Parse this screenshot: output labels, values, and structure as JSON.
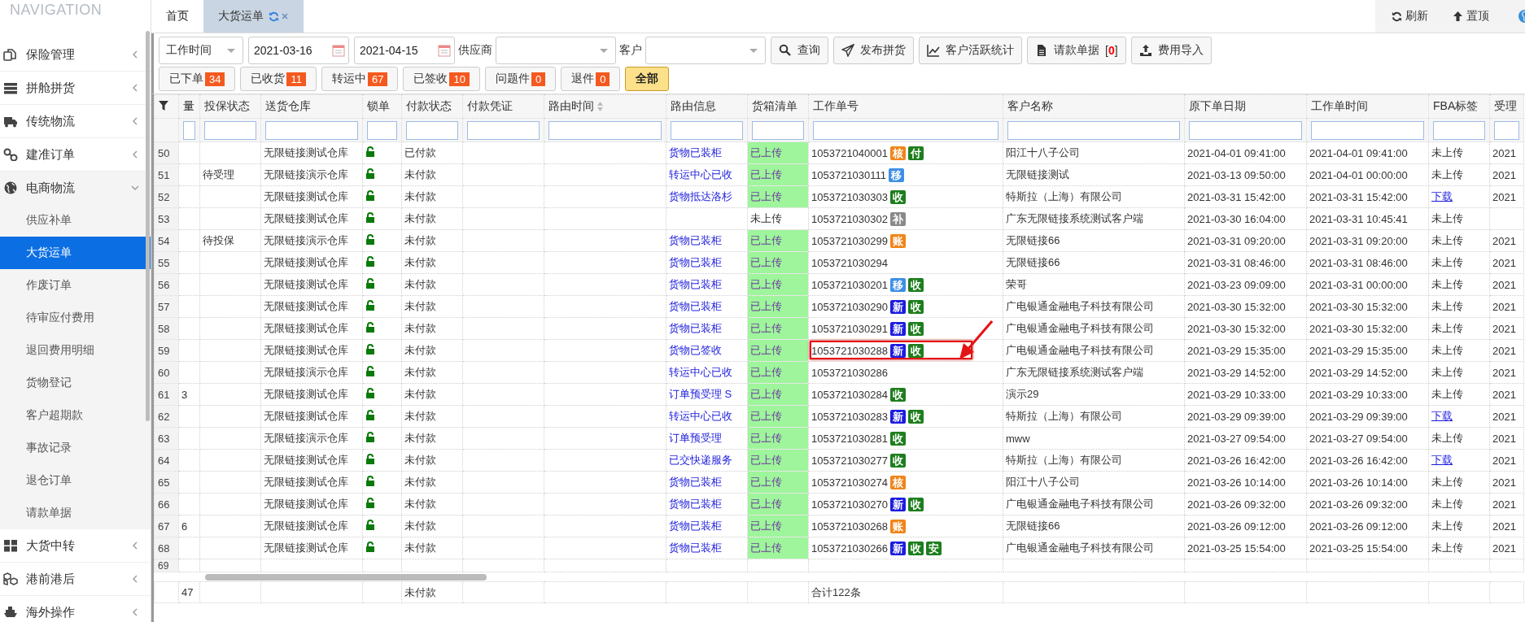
{
  "navigation": {
    "title": "NAVIGATION",
    "items": [
      {
        "label": "保险管理",
        "expanded": false
      },
      {
        "label": "拼舱拼货",
        "expanded": false
      },
      {
        "label": "传统物流",
        "expanded": false
      },
      {
        "label": "建准订单",
        "expanded": false
      },
      {
        "label": "电商物流",
        "expanded": true,
        "children": [
          {
            "label": "供应补单",
            "selected": false
          },
          {
            "label": "大货运单",
            "selected": true
          },
          {
            "label": "作废订单",
            "selected": false
          },
          {
            "label": "待审应付费用",
            "selected": false
          },
          {
            "label": "退回费用明细",
            "selected": false
          },
          {
            "label": "货物登记",
            "selected": false
          },
          {
            "label": "客户超期款",
            "selected": false
          },
          {
            "label": "事故记录",
            "selected": false
          },
          {
            "label": "退仓订单",
            "selected": false
          },
          {
            "label": "请款单据",
            "selected": false
          }
        ]
      },
      {
        "label": "大货中转",
        "expanded": false
      },
      {
        "label": "港前港后",
        "expanded": false
      },
      {
        "label": "海外操作",
        "expanded": false
      }
    ]
  },
  "tabs": [
    {
      "label": "首页",
      "selected": false,
      "closable": false
    },
    {
      "label": "大货运单",
      "selected": true,
      "closable": true
    }
  ],
  "top_actions": [
    {
      "label": "刷新"
    },
    {
      "label": "置顶"
    }
  ],
  "filters": {
    "time_field": {
      "value": "工作时间"
    },
    "date_from": {
      "value": "2021-03-16"
    },
    "date_to": {
      "value": "2021-04-15"
    },
    "supplier": {
      "label": "供应商"
    },
    "customer": {
      "label": "客户"
    }
  },
  "toolbar_buttons": [
    {
      "label": "查询"
    },
    {
      "label": "发布拼货"
    },
    {
      "label": "客户活跃统计"
    },
    {
      "label": "请款单据",
      "count": "[**0**]"
    },
    {
      "label": "费用导入"
    }
  ],
  "status_buttons": [
    {
      "label": "已下单",
      "count": "34",
      "selected": false
    },
    {
      "label": "已收货",
      "count": "11",
      "selected": false
    },
    {
      "label": "转运中",
      "count": "67",
      "selected": false
    },
    {
      "label": "已签收",
      "count": "10",
      "selected": false
    },
    {
      "label": "问题件",
      "count": "0",
      "selected": false
    },
    {
      "label": "退件",
      "count": "0",
      "selected": false
    },
    {
      "label": "全部",
      "selected": true
    }
  ],
  "table": {
    "columns": [
      {
        "label": "量",
        "sortable": false
      },
      {
        "label": "投保状态",
        "sortable": false
      },
      {
        "label": "送货仓库",
        "sortable": false
      },
      {
        "label": "锁单",
        "sortable": false
      },
      {
        "label": "付款状态",
        "sortable": false
      },
      {
        "label": "付款凭证",
        "sortable": false
      },
      {
        "label": "路由时间",
        "sortable": true
      },
      {
        "label": "路由信息",
        "sortable": false
      },
      {
        "label": "货箱清单",
        "sortable": false
      },
      {
        "label": "工作单号",
        "sortable": false
      },
      {
        "label": "客户名称",
        "sortable": false
      },
      {
        "label": "原下单日期",
        "sortable": false
      },
      {
        "label": "工作单时间",
        "sortable": false
      },
      {
        "label": "FBA标签",
        "sortable": false
      },
      {
        "label": "受理",
        "sortable": false
      }
    ],
    "rows": [
      {
        "number": "50",
        "warehouse": "无限链接测试仓库",
        "locked": false,
        "payment_status": "已付款",
        "route_info": "货物已装柜",
        "packing_list": {
          "text": "已上传",
          "uploaded": true
        },
        "work_order": {
          "number": "1053721040001",
          "tags": [
            {
              "text": "核",
              "color": "#f08519"
            },
            {
              "text": "付",
              "color": "#1e7e1e"
            }
          ],
          "highlighted": false
        },
        "customer": "阳江十八子公司",
        "order_date": "2021-04-01 09:41:00",
        "work_order_time": "2021-04-01 09:41:00",
        "fba_label": {
          "text": "未上传",
          "link": false
        },
        "acceptance": "2021"
      },
      {
        "number": "51",
        "insurance_status": "待受理",
        "warehouse": "无限链接演示仓库",
        "locked": false,
        "payment_status": "未付款",
        "route_info": "转运中心已收",
        "packing_list": {
          "text": "已上传",
          "uploaded": true
        },
        "work_order": {
          "number": "1053721030111",
          "tags": [
            {
              "text": "移",
              "color": "#3d8fe6"
            }
          ],
          "highlighted": false
        },
        "customer": "无限链接测试",
        "order_date": "2021-03-13 09:50:00",
        "work_order_time": "2021-04-01 00:00:00",
        "fba_label": {
          "text": "未上传",
          "link": false
        },
        "acceptance": "2021"
      },
      {
        "number": "52",
        "warehouse": "无限链接测试仓库",
        "locked": false,
        "payment_status": "未付款",
        "route_info": "货物抵达洛杉",
        "packing_list": {
          "text": "已上传",
          "uploaded": true
        },
        "work_order": {
          "number": "1053721030303",
          "tags": [
            {
              "text": "收",
              "color": "#1e7e1e"
            }
          ],
          "highlighted": false
        },
        "customer": "特斯拉（上海）有限公司",
        "order_date": "2021-03-31 15:42:00",
        "work_order_time": "2021-03-31 15:42:00",
        "fba_label": {
          "text": "下载",
          "link": true
        },
        "acceptance": "2021"
      },
      {
        "number": "53",
        "warehouse": "无限链接测试仓库",
        "locked": false,
        "payment_status": "未付款",
        "packing_list": {
          "text": "未上传",
          "uploaded": false
        },
        "work_order": {
          "number": "1053721030302",
          "tags": [
            {
              "text": "补",
              "color": "#8a8a8a"
            }
          ],
          "highlighted": false
        },
        "customer": "广东无限链接系统测试客户端",
        "order_date": "2021-03-30 16:04:00",
        "work_order_time": "2021-03-31 10:45:41",
        "fba_label": {
          "text": "未上传",
          "link": false
        }
      },
      {
        "number": "54",
        "insurance_status": "待投保",
        "warehouse": "无限链接演示仓库",
        "locked": false,
        "payment_status": "未付款",
        "route_info": "货物已装柜",
        "packing_list": {
          "text": "已上传",
          "uploaded": true
        },
        "work_order": {
          "number": "1053721030299",
          "tags": [
            {
              "text": "账",
              "color": "#f08519"
            }
          ],
          "highlighted": false
        },
        "customer": "无限链接66",
        "order_date": "2021-03-31 09:20:00",
        "work_order_time": "2021-03-31 09:20:00",
        "fba_label": {
          "text": "未上传",
          "link": false
        },
        "acceptance": "2021"
      },
      {
        "number": "55",
        "warehouse": "无限链接测试仓库",
        "locked": false,
        "payment_status": "未付款",
        "route_info": "货物已装柜",
        "packing_list": {
          "text": "已上传",
          "uploaded": true
        },
        "work_order": {
          "number": "1053721030294",
          "highlighted": false
        },
        "customer": "无限链接66",
        "order_date": "2021-03-31 08:46:00",
        "work_order_time": "2021-03-31 08:46:00",
        "fba_label": {
          "text": "未上传",
          "link": false
        },
        "acceptance": "2021"
      },
      {
        "number": "56",
        "warehouse": "无限链接测试仓库",
        "locked": false,
        "payment_status": "未付款",
        "route_info": "货物已装柜",
        "packing_list": {
          "text": "已上传",
          "uploaded": true
        },
        "work_order": {
          "number": "1053721030201",
          "tags": [
            {
              "text": "移",
              "color": "#3d8fe6"
            },
            {
              "text": "收",
              "color": "#1e7e1e"
            }
          ],
          "highlighted": false
        },
        "customer": "荣哥",
        "order_date": "2021-03-23 09:09:00",
        "work_order_time": "2021-03-31 00:00:00",
        "fba_label": {
          "text": "未上传",
          "link": false
        },
        "acceptance": "2021"
      },
      {
        "number": "57",
        "warehouse": "无限链接测试仓库",
        "locked": false,
        "payment_status": "未付款",
        "route_info": "货物已装柜",
        "packing_list": {
          "text": "已上传",
          "uploaded": true
        },
        "work_order": {
          "number": "1053721030290",
          "tags": [
            {
              "text": "新",
              "color": "#1c1ce0"
            },
            {
              "text": "收",
              "color": "#1e7e1e"
            }
          ],
          "highlighted": false
        },
        "customer": "广电银通金融电子科技有限公司",
        "order_date": "2021-03-30 15:32:00",
        "work_order_time": "2021-03-30 15:32:00",
        "fba_label": {
          "text": "未上传",
          "link": false
        },
        "acceptance": "2021"
      },
      {
        "number": "58",
        "warehouse": "无限链接测试仓库",
        "locked": false,
        "payment_status": "未付款",
        "route_info": "货物已装柜",
        "packing_list": {
          "text": "已上传",
          "uploaded": true
        },
        "work_order": {
          "number": "1053721030291",
          "tags": [
            {
              "text": "新",
              "color": "#1c1ce0"
            },
            {
              "text": "收",
              "color": "#1e7e1e"
            }
          ],
          "highlighted": false
        },
        "customer": "广电银通金融电子科技有限公司",
        "order_date": "2021-03-30 15:32:00",
        "work_order_time": "2021-03-30 15:32:00",
        "fba_label": {
          "text": "未上传",
          "link": false
        },
        "acceptance": "2021"
      },
      {
        "number": "59",
        "warehouse": "无限链接测试仓库",
        "locked": false,
        "payment_status": "未付款",
        "route_info": "货物已签收",
        "packing_list": {
          "text": "已上传",
          "uploaded": true
        },
        "work_order": {
          "number": "1053721030288",
          "tags": [
            {
              "text": "新",
              "color": "#1c1ce0"
            },
            {
              "text": "收",
              "color": "#1e7e1e"
            }
          ],
          "highlighted": true
        },
        "customer": "广电银通金融电子科技有限公司",
        "order_date": "2021-03-29 15:35:00",
        "work_order_time": "2021-03-29 15:35:00",
        "fba_label": {
          "text": "未上传",
          "link": false
        },
        "acceptance": "2021"
      },
      {
        "number": "60",
        "warehouse": "无限链接演示仓库",
        "locked": false,
        "payment_status": "未付款",
        "route_info": "转运中心已收",
        "packing_list": {
          "text": "已上传",
          "uploaded": true
        },
        "work_order": {
          "number": "1053721030286",
          "highlighted": false
        },
        "customer": "广东无限链接系统测试客户端",
        "order_date": "2021-03-29 14:52:00",
        "work_order_time": "2021-03-29 14:52:00",
        "fba_label": {
          "text": "未上传",
          "link": false
        },
        "acceptance": "2021"
      },
      {
        "number": "61",
        "quantity": "3",
        "warehouse": "无限链接测试仓库",
        "locked": false,
        "payment_status": "未付款",
        "route_info": "订单预受理 S",
        "packing_list": {
          "text": "已上传",
          "uploaded": true
        },
        "work_order": {
          "number": "1053721030284",
          "tags": [
            {
              "text": "收",
              "color": "#1e7e1e"
            }
          ],
          "highlighted": false
        },
        "customer": "演示29",
        "order_date": "2021-03-29 10:33:00",
        "work_order_time": "2021-03-29 10:33:00",
        "fba_label": {
          "text": "未上传",
          "link": false
        },
        "acceptance": "2021"
      },
      {
        "number": "62",
        "warehouse": "无限链接测试仓库",
        "locked": false,
        "payment_status": "未付款",
        "route_info": "转运中心已收",
        "packing_list": {
          "text": "已上传",
          "uploaded": true
        },
        "work_order": {
          "number": "1053721030283",
          "tags": [
            {
              "text": "新",
              "color": "#1c1ce0"
            },
            {
              "text": "收",
              "color": "#1e7e1e"
            }
          ],
          "highlighted": false
        },
        "customer": "特斯拉（上海）有限公司",
        "order_date": "2021-03-29 09:39:00",
        "work_order_time": "2021-03-29 09:39:00",
        "fba_label": {
          "text": "下载",
          "link": true
        },
        "acceptance": "2021"
      },
      {
        "number": "63",
        "warehouse": "无限链接演示仓库",
        "locked": false,
        "payment_status": "未付款",
        "route_info": "订单预受理",
        "packing_list": {
          "text": "已上传",
          "uploaded": true
        },
        "work_order": {
          "number": "1053721030281",
          "tags": [
            {
              "text": "收",
              "color": "#1e7e1e"
            }
          ],
          "highlighted": false
        },
        "customer": "mww",
        "order_date": "2021-03-27 09:54:00",
        "work_order_time": "2021-03-27 09:54:00",
        "fba_label": {
          "text": "未上传",
          "link": false
        },
        "acceptance": "2021"
      },
      {
        "number": "64",
        "warehouse": "无限链接测试仓库",
        "locked": false,
        "payment_status": "未付款",
        "route_info": "已交快递服务",
        "packing_list": {
          "text": "已上传",
          "uploaded": true
        },
        "work_order": {
          "number": "1053721030277",
          "tags": [
            {
              "text": "收",
              "color": "#1e7e1e"
            }
          ],
          "highlighted": false
        },
        "customer": "特斯拉（上海）有限公司",
        "order_date": "2021-03-26 16:42:00",
        "work_order_time": "2021-03-26 16:42:00",
        "fba_label": {
          "text": "下载",
          "link": true
        },
        "acceptance": "2021"
      },
      {
        "number": "65",
        "warehouse": "无限链接测试仓库",
        "locked": false,
        "payment_status": "未付款",
        "route_info": "货物已装柜",
        "packing_list": {
          "text": "已上传",
          "uploaded": true
        },
        "work_order": {
          "number": "1053721030274",
          "tags": [
            {
              "text": "核",
              "color": "#f08519"
            }
          ],
          "highlighted": false
        },
        "customer": "阳江十八子公司",
        "order_date": "2021-03-26 10:14:00",
        "work_order_time": "2021-03-26 10:14:00",
        "fba_label": {
          "text": "未上传",
          "link": false
        },
        "acceptance": "2021"
      },
      {
        "number": "66",
        "warehouse": "无限链接测试仓库",
        "locked": false,
        "payment_status": "未付款",
        "route_info": "货物已装柜",
        "packing_list": {
          "text": "已上传",
          "uploaded": true
        },
        "work_order": {
          "number": "1053721030270",
          "tags": [
            {
              "text": "新",
              "color": "#1c1ce0"
            },
            {
              "text": "收",
              "color": "#1e7e1e"
            }
          ],
          "highlighted": false
        },
        "customer": "广电银通金融电子科技有限公司",
        "order_date": "2021-03-26 09:32:00",
        "work_order_time": "2021-03-26 09:32:00",
        "fba_label": {
          "text": "未上传",
          "link": false
        },
        "acceptance": "2021"
      },
      {
        "number": "67",
        "quantity": "6",
        "warehouse": "无限链接测试仓库",
        "locked": false,
        "payment_status": "未付款",
        "route_info": "货物已装柜",
        "packing_list": {
          "text": "已上传",
          "uploaded": true
        },
        "work_order": {
          "number": "1053721030268",
          "tags": [
            {
              "text": "账",
              "color": "#f08519"
            }
          ],
          "highlighted": false
        },
        "customer": "无限链接66",
        "order_date": "2021-03-26 09:12:00",
        "work_order_time": "2021-03-26 09:12:00",
        "fba_label": {
          "text": "未上传",
          "link": false
        },
        "acceptance": "2021"
      },
      {
        "number": "68",
        "warehouse": "无限链接测试仓库",
        "locked": false,
        "payment_status": "未付款",
        "route_info": "货物已装柜",
        "packing_list": {
          "text": "已上传",
          "uploaded": true
        },
        "work_order": {
          "number": "1053721030266",
          "tags": [
            {
              "text": "新",
              "color": "#1c1ce0"
            },
            {
              "text": "收",
              "color": "#1e7e1e"
            },
            {
              "text": "安",
              "color": "#1e7e1e"
            }
          ],
          "highlighted": false
        },
        "customer": "广电银通金融电子科技有限公司",
        "order_date": "2021-03-25 15:54:00",
        "work_order_time": "2021-03-25 15:54:00",
        "fba_label": {
          "text": "未上传",
          "link": false
        },
        "acceptance": "2021"
      },
      {
        "number": "69",
        "partial": true
      }
    ],
    "footer": {
      "quantity": "47",
      "payment_status": "未付款",
      "work_order": "合计122条"
    }
  }
}
